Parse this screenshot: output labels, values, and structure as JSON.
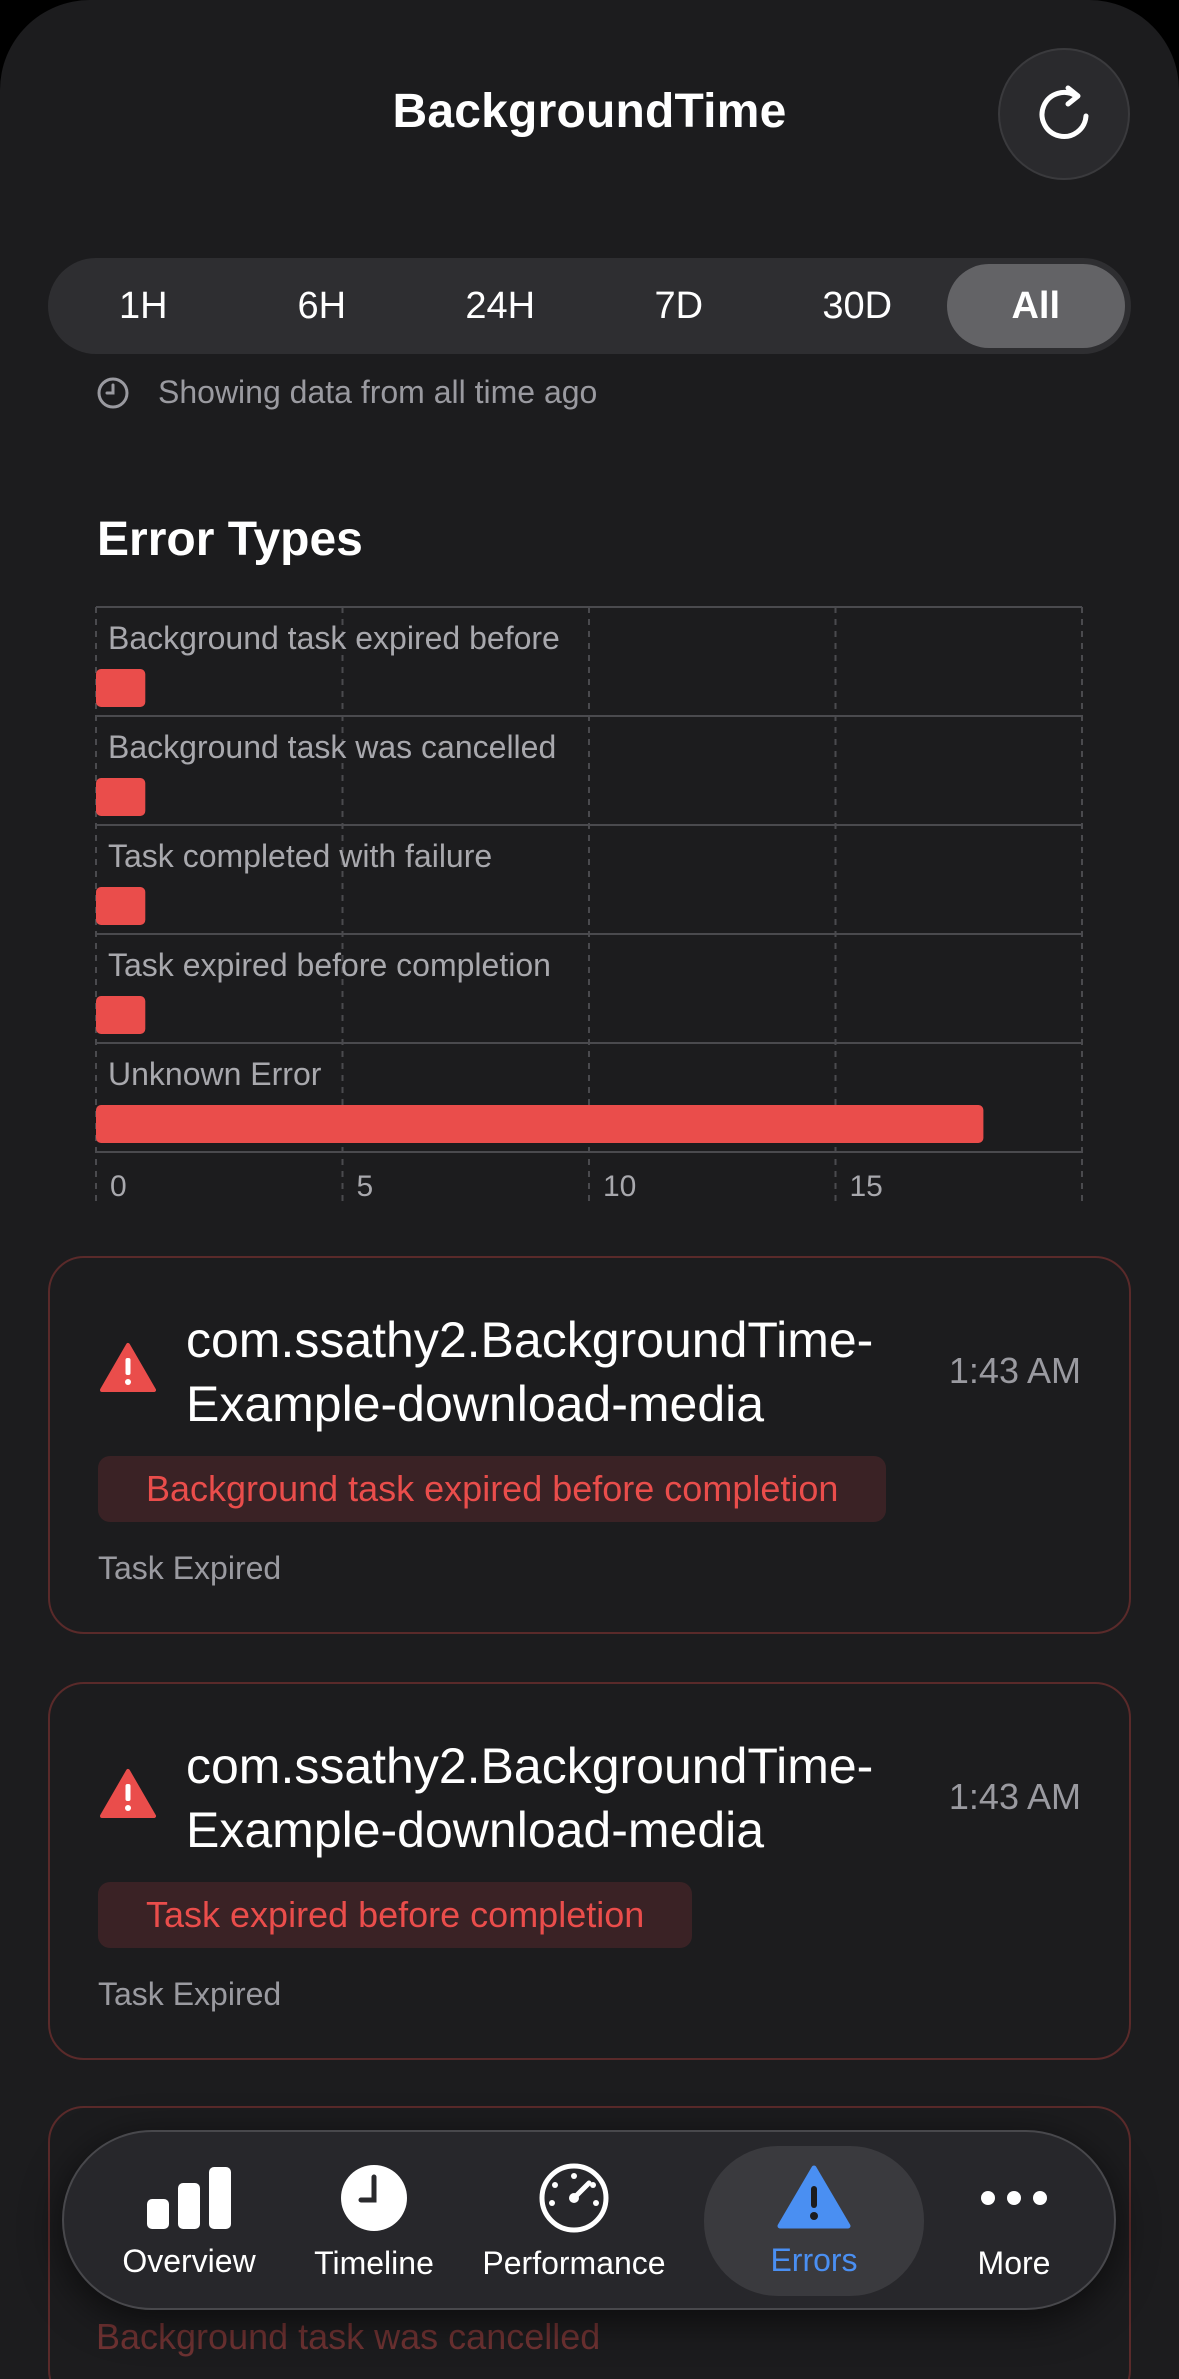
{
  "header": {
    "title": "BackgroundTime",
    "refresh_icon": "refresh-icon"
  },
  "time_range": {
    "options": [
      "1H",
      "6H",
      "24H",
      "7D",
      "30D",
      "All"
    ],
    "selected": "All",
    "note": "Showing data from all time ago"
  },
  "section": {
    "title": "Error Types"
  },
  "chart_data": {
    "type": "bar",
    "orientation": "horizontal",
    "title": "Error Types",
    "categories": [
      "Background task expired before",
      "Background task was cancelled",
      "Task completed with failure",
      "Task expired before completion",
      "Unknown Error"
    ],
    "values": [
      1,
      1,
      1,
      1,
      18
    ],
    "xlim": [
      0,
      20
    ],
    "xticks": [
      "0",
      "5",
      "10",
      "15"
    ],
    "grid": true,
    "bar_color": "#ea4d4b"
  },
  "errors": [
    {
      "name": "com.ssathy2.BackgroundTime-Example-download-media",
      "name_line1": "com.ssathy2.BackgroundTime-",
      "name_line2": "Example-download-media",
      "time": "1:43 AM",
      "message": "Background task expired before completion",
      "status": "Task Expired"
    },
    {
      "name": "com.ssathy2.BackgroundTime-Example-download-media",
      "name_line1": "com.ssathy2.BackgroundTime-",
      "name_line2": "Example-download-media",
      "time": "1:43 AM",
      "message": "Task expired before completion",
      "status": "Task Expired"
    },
    {
      "message": "Background task was cancelled"
    }
  ],
  "tabbar": {
    "items": [
      {
        "label": "Overview",
        "icon": "bar-chart-icon"
      },
      {
        "label": "Timeline",
        "icon": "clock-icon"
      },
      {
        "label": "Performance",
        "icon": "gauge-icon"
      },
      {
        "label": "Errors",
        "icon": "warning-icon"
      },
      {
        "label": "More",
        "icon": "ellipsis-icon"
      }
    ],
    "selected": "Errors",
    "accent": "#4a8ff2"
  },
  "colors": {
    "background": "#1c1c1e",
    "error": "#ea4d4b",
    "accent": "#4a8ff2"
  }
}
